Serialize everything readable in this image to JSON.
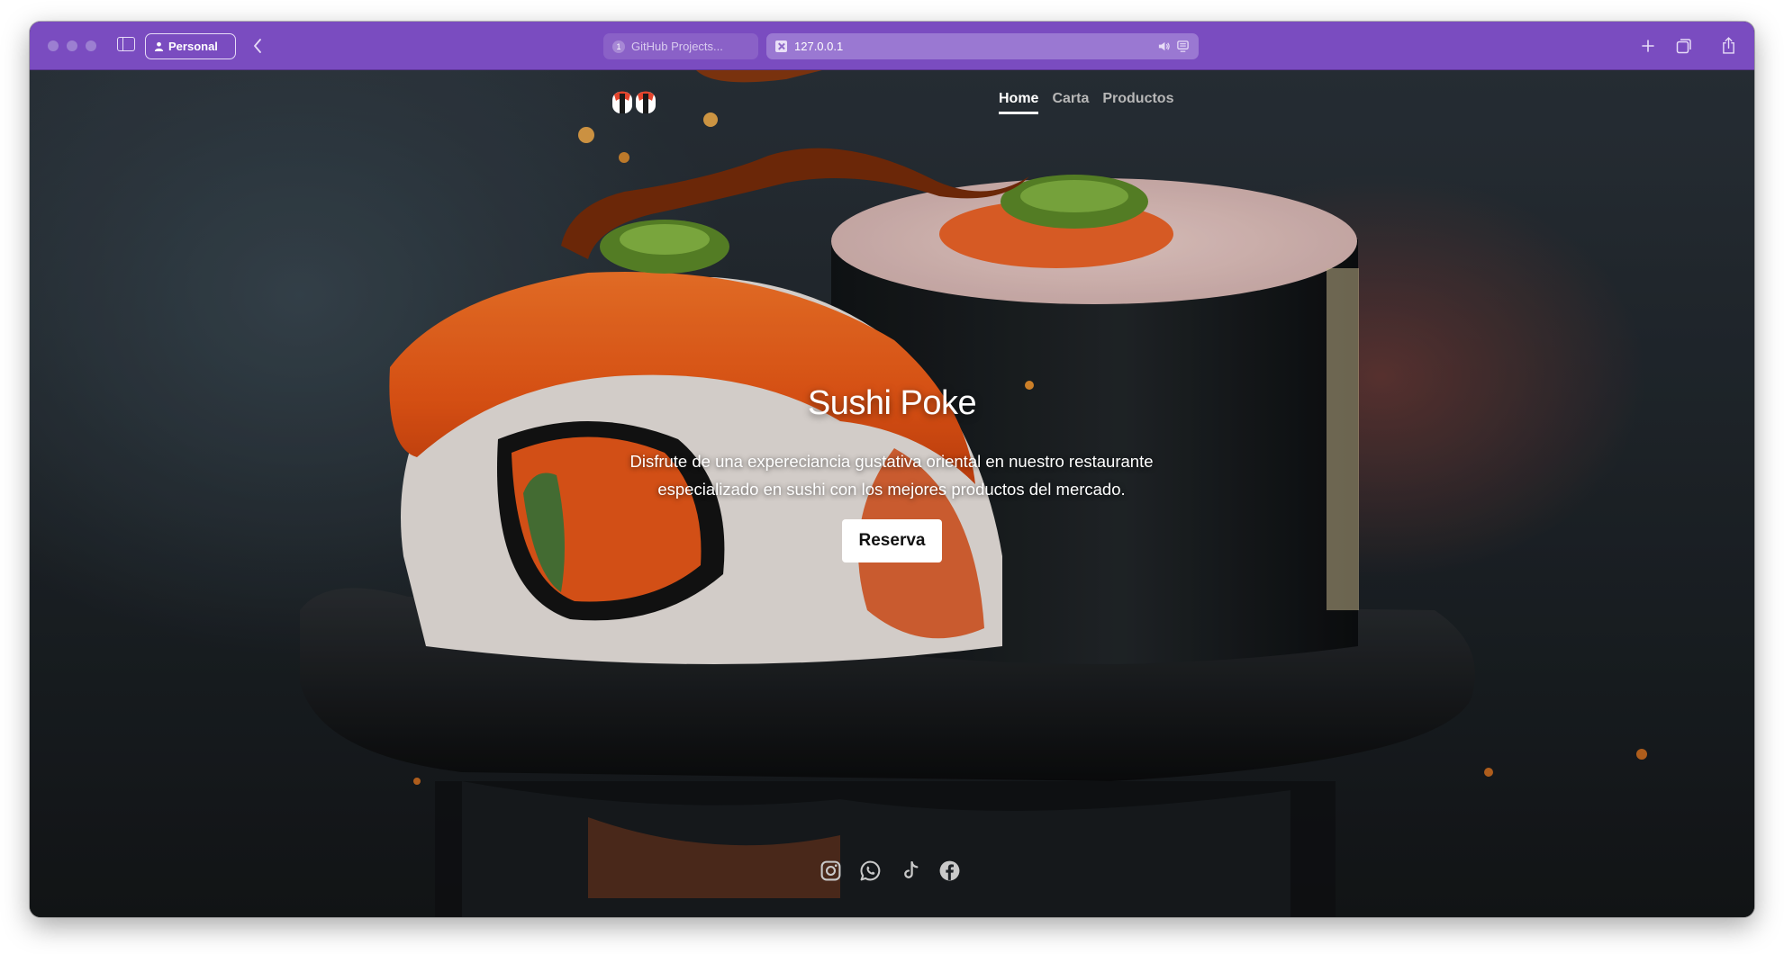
{
  "browser": {
    "profile_label": "Personal",
    "tabs": [
      {
        "label": "GitHub Projects...",
        "badge": "1"
      },
      {
        "label": "127.0.0.1"
      }
    ],
    "accent_color": "#7a4cc0"
  },
  "site": {
    "nav": [
      {
        "label": "Home",
        "active": true
      },
      {
        "label": "Carta",
        "active": false
      },
      {
        "label": "Productos",
        "active": false
      }
    ],
    "hero": {
      "title": "Sushi Poke",
      "description": "Disfrute de una expereciancia gustativa oriental en nuestro restaurante especializado en sushi con los mejores productos del mercado.",
      "cta_label": "Reserva"
    },
    "social_icons": [
      "instagram-icon",
      "whatsapp-icon",
      "tiktok-icon",
      "facebook-icon"
    ]
  }
}
